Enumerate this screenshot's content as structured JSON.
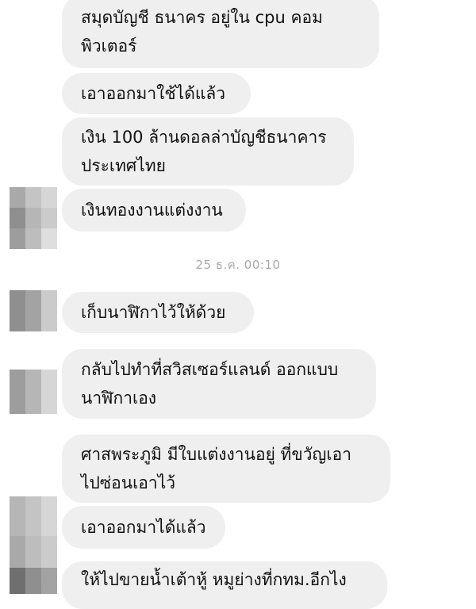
{
  "conversation": {
    "messages": [
      {
        "lines": [
          "สมุดบัญชี ธนาคร อยู่ใน cpu คอม",
          "พิวเตอร์"
        ]
      },
      {
        "lines": [
          "เอาออกมาใช้ได้แล้ว"
        ]
      },
      {
        "lines": [
          "เงิน 100 ล้านดอลล่าบัญชีธนาคาร",
          "ประเทศไทย"
        ]
      },
      {
        "lines": [
          "เงินทองงานแต่งงาน"
        ]
      },
      {
        "lines": [
          "เก็บนาฬิกาไว้ให้ด้วย"
        ]
      },
      {
        "lines": [
          "กลับไปทำที่สวิสเซอร์แลนด์ ออกแบบ",
          "นาฬิกาเอง"
        ]
      },
      {
        "lines": [
          "ศาสพระภูมิ มีใบแต่งงานอยู่ ที่ขวัญเอา",
          "ไปซ่อนเอาไว้"
        ]
      },
      {
        "lines": [
          "เอาออกมาได้แล้ว"
        ]
      },
      {
        "lines": [
          "ให้ไปขายน้ำเต้าหู้ หมูย่างที่กทม.อีกไง"
        ]
      }
    ],
    "timestamp": "25 ธ.ค. 00:10"
  },
  "avatar": {
    "icon": "blurred-avatar-icon",
    "colors": [
      "#a9a9a9",
      "#c4c4c4",
      "#8f8f8f",
      "#b6b6b6",
      "#d6d6d6",
      "#9d9d9d",
      "#bdbdbd",
      "#cbcbcb",
      "#a3a3a3"
    ]
  },
  "theme": {
    "bubble_color": "#efefef",
    "text_color": "#111111",
    "timestamp_color": "#a8a8a8"
  }
}
